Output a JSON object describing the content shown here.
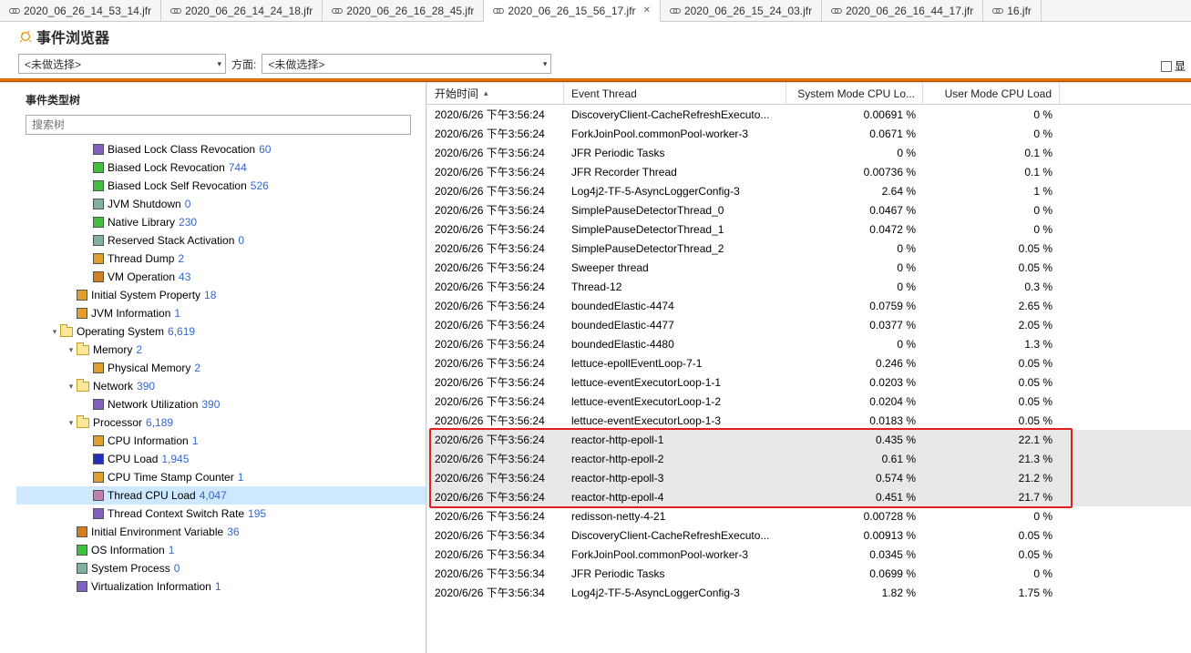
{
  "tabs": [
    {
      "label": "2020_06_26_14_53_14.jfr",
      "active": false,
      "closable": false
    },
    {
      "label": "2020_06_26_14_24_18.jfr",
      "active": false,
      "closable": false
    },
    {
      "label": "2020_06_26_16_28_45.jfr",
      "active": false,
      "closable": false
    },
    {
      "label": "2020_06_26_15_56_17.jfr",
      "active": true,
      "closable": true
    },
    {
      "label": "2020_06_26_15_24_03.jfr",
      "active": false,
      "closable": false
    },
    {
      "label": "2020_06_26_16_44_17.jfr",
      "active": false,
      "closable": false
    },
    {
      "label": "16.jfr",
      "active": false,
      "closable": false
    }
  ],
  "page_title": "事件浏览器",
  "filter": {
    "combo1": "<未做选择>",
    "aspect_label": "方面:",
    "combo2": "<未做选择>",
    "display_cut": "显"
  },
  "tree_title": "事件类型树",
  "search_placeholder": "搜索树",
  "tree": [
    {
      "indent": 4,
      "color": "#8060c0",
      "label": "Biased Lock Class Revocation",
      "count": "60"
    },
    {
      "indent": 4,
      "color": "#40c040",
      "label": "Biased Lock Revocation",
      "count": "744"
    },
    {
      "indent": 4,
      "color": "#40c040",
      "label": "Biased Lock Self Revocation",
      "count": "526"
    },
    {
      "indent": 4,
      "color": "#80b0a0",
      "label": "JVM Shutdown",
      "count": "0"
    },
    {
      "indent": 4,
      "color": "#40c040",
      "label": "Native Library",
      "count": "230"
    },
    {
      "indent": 4,
      "color": "#80b0a0",
      "label": "Reserved Stack Activation",
      "count": "0"
    },
    {
      "indent": 4,
      "color": "#e0a030",
      "label": "Thread Dump",
      "count": "2"
    },
    {
      "indent": 4,
      "color": "#d08020",
      "label": "VM Operation",
      "count": "43"
    },
    {
      "indent": 3,
      "color": "#e0a030",
      "label": "Initial System Property",
      "count": "18"
    },
    {
      "indent": 3,
      "color": "#e0a030",
      "label": "JVM Information",
      "count": "1"
    },
    {
      "indent": 2,
      "folder": true,
      "expand": "open",
      "label": "Operating System",
      "count": "6,619"
    },
    {
      "indent": 3,
      "folder": true,
      "expand": "open",
      "label": "Memory",
      "count": "2"
    },
    {
      "indent": 4,
      "color": "#e0a030",
      "label": "Physical Memory",
      "count": "2"
    },
    {
      "indent": 3,
      "folder": true,
      "expand": "open",
      "label": "Network",
      "count": "390"
    },
    {
      "indent": 4,
      "color": "#8060c0",
      "label": "Network Utilization",
      "count": "390"
    },
    {
      "indent": 3,
      "folder": true,
      "expand": "open",
      "label": "Processor",
      "count": "6,189"
    },
    {
      "indent": 4,
      "color": "#e0a030",
      "label": "CPU Information",
      "count": "1"
    },
    {
      "indent": 4,
      "color": "#2030c0",
      "label": "CPU Load",
      "count": "1,945"
    },
    {
      "indent": 4,
      "color": "#e0a030",
      "label": "CPU Time Stamp Counter",
      "count": "1"
    },
    {
      "indent": 4,
      "color": "#c080b0",
      "label": "Thread CPU Load",
      "count": "4,047",
      "selected": true
    },
    {
      "indent": 4,
      "color": "#8060c0",
      "label": "Thread Context Switch Rate",
      "count": "195"
    },
    {
      "indent": 3,
      "color": "#d08020",
      "label": "Initial Environment Variable",
      "count": "36"
    },
    {
      "indent": 3,
      "color": "#40c040",
      "label": "OS Information",
      "count": "1"
    },
    {
      "indent": 3,
      "color": "#80b0a0",
      "label": "System Process",
      "count": "0"
    },
    {
      "indent": 3,
      "color": "#8060c0",
      "label": "Virtualization Information",
      "count": "1"
    }
  ],
  "columns": {
    "c0": "开始时间",
    "c1": "Event Thread",
    "c2": "System Mode CPU Lo...",
    "c3": "User Mode CPU Load"
  },
  "rows": [
    {
      "t": "2020/6/26 下午3:56:24",
      "th": "DiscoveryClient-CacheRefreshExecuto...",
      "s": "0.00691 %",
      "u": "0 %"
    },
    {
      "t": "2020/6/26 下午3:56:24",
      "th": "ForkJoinPool.commonPool-worker-3",
      "s": "0.0671 %",
      "u": "0 %"
    },
    {
      "t": "2020/6/26 下午3:56:24",
      "th": "JFR Periodic Tasks",
      "s": "0 %",
      "u": "0.1 %"
    },
    {
      "t": "2020/6/26 下午3:56:24",
      "th": "JFR Recorder Thread",
      "s": "0.00736 %",
      "u": "0.1 %"
    },
    {
      "t": "2020/6/26 下午3:56:24",
      "th": "Log4j2-TF-5-AsyncLoggerConfig-3",
      "s": "2.64 %",
      "u": "1 %"
    },
    {
      "t": "2020/6/26 下午3:56:24",
      "th": "SimplePauseDetectorThread_0",
      "s": "0.0467 %",
      "u": "0 %"
    },
    {
      "t": "2020/6/26 下午3:56:24",
      "th": "SimplePauseDetectorThread_1",
      "s": "0.0472 %",
      "u": "0 %"
    },
    {
      "t": "2020/6/26 下午3:56:24",
      "th": "SimplePauseDetectorThread_2",
      "s": "0 %",
      "u": "0.05 %"
    },
    {
      "t": "2020/6/26 下午3:56:24",
      "th": "Sweeper thread",
      "s": "0 %",
      "u": "0.05 %"
    },
    {
      "t": "2020/6/26 下午3:56:24",
      "th": "Thread-12",
      "s": "0 %",
      "u": "0.3 %"
    },
    {
      "t": "2020/6/26 下午3:56:24",
      "th": "boundedElastic-4474",
      "s": "0.0759 %",
      "u": "2.65 %"
    },
    {
      "t": "2020/6/26 下午3:56:24",
      "th": "boundedElastic-4477",
      "s": "0.0377 %",
      "u": "2.05 %"
    },
    {
      "t": "2020/6/26 下午3:56:24",
      "th": "boundedElastic-4480",
      "s": "0 %",
      "u": "1.3 %"
    },
    {
      "t": "2020/6/26 下午3:56:24",
      "th": "lettuce-epollEventLoop-7-1",
      "s": "0.246 %",
      "u": "0.05 %"
    },
    {
      "t": "2020/6/26 下午3:56:24",
      "th": "lettuce-eventExecutorLoop-1-1",
      "s": "0.0203 %",
      "u": "0.05 %"
    },
    {
      "t": "2020/6/26 下午3:56:24",
      "th": "lettuce-eventExecutorLoop-1-2",
      "s": "0.0204 %",
      "u": "0.05 %"
    },
    {
      "t": "2020/6/26 下午3:56:24",
      "th": "lettuce-eventExecutorLoop-1-3",
      "s": "0.0183 %",
      "u": "0.05 %"
    },
    {
      "t": "2020/6/26 下午3:56:24",
      "th": "reactor-http-epoll-1",
      "s": "0.435 %",
      "u": "22.1 %",
      "hl": true
    },
    {
      "t": "2020/6/26 下午3:56:24",
      "th": "reactor-http-epoll-2",
      "s": "0.61 %",
      "u": "21.3 %",
      "hl": true
    },
    {
      "t": "2020/6/26 下午3:56:24",
      "th": "reactor-http-epoll-3",
      "s": "0.574 %",
      "u": "21.2 %",
      "hl": true
    },
    {
      "t": "2020/6/26 下午3:56:24",
      "th": "reactor-http-epoll-4",
      "s": "0.451 %",
      "u": "21.7 %",
      "hl": true
    },
    {
      "t": "2020/6/26 下午3:56:24",
      "th": "redisson-netty-4-21",
      "s": "0.00728 %",
      "u": "0 %"
    },
    {
      "t": "2020/6/26 下午3:56:34",
      "th": "DiscoveryClient-CacheRefreshExecuto...",
      "s": "0.00913 %",
      "u": "0.05 %"
    },
    {
      "t": "2020/6/26 下午3:56:34",
      "th": "ForkJoinPool.commonPool-worker-3",
      "s": "0.0345 %",
      "u": "0.05 %"
    },
    {
      "t": "2020/6/26 下午3:56:34",
      "th": "JFR Periodic Tasks",
      "s": "0.0699 %",
      "u": "0 %"
    },
    {
      "t": "2020/6/26 下午3:56:34",
      "th": "Log4j2-TF-5-AsyncLoggerConfig-3",
      "s": "1.82 %",
      "u": "1.75 %"
    }
  ]
}
